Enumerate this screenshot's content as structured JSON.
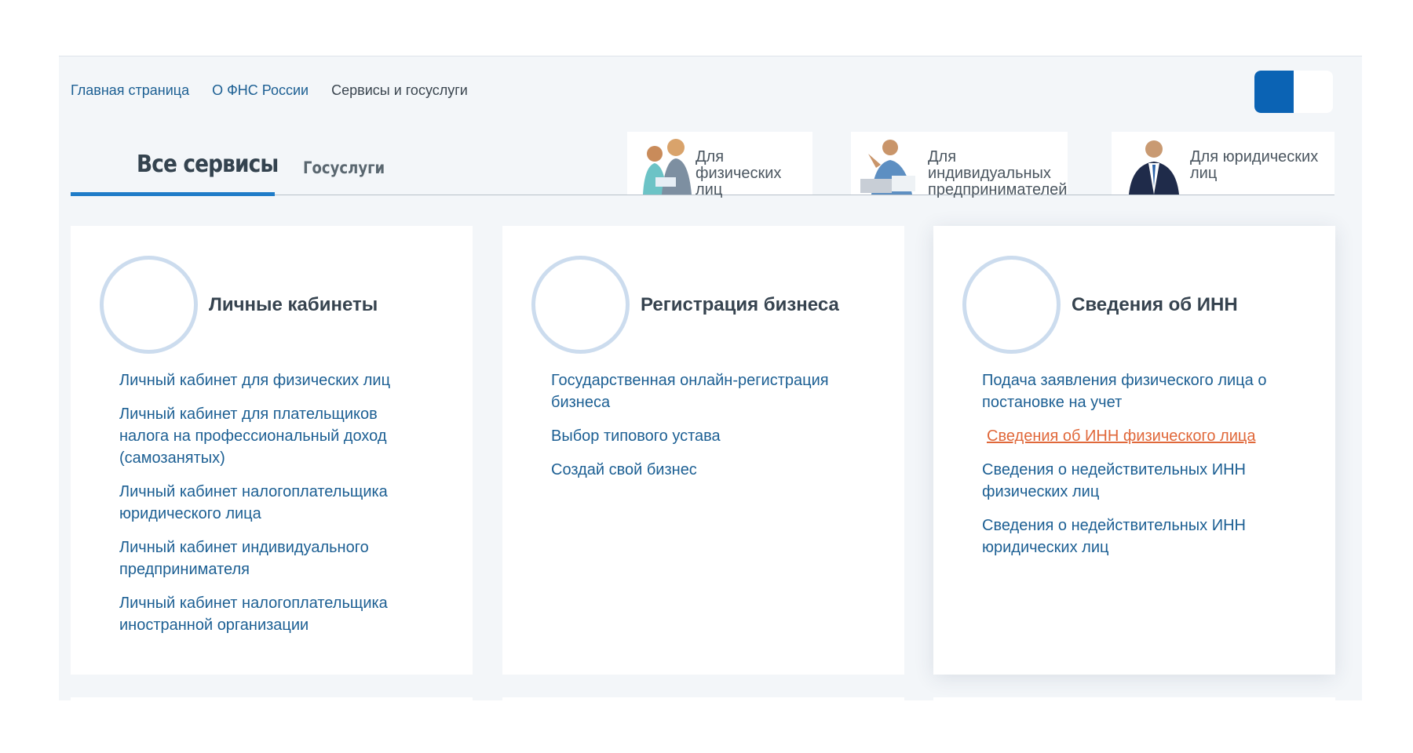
{
  "breadcrumb": [
    {
      "label": "Главная страница"
    },
    {
      "label": "О ФНС России"
    },
    {
      "label": "Сервисы и госуслуги"
    }
  ],
  "tabs": {
    "main": "Все сервисы",
    "second": "Госуслуги"
  },
  "audience": [
    {
      "label": "Для физических лиц"
    },
    {
      "label": "Для индивидуальных предпринимателей"
    },
    {
      "label": "Для юридических лиц"
    }
  ],
  "cards": [
    {
      "title": "Личные кабинеты",
      "links": [
        "Личный кабинет для физических лиц",
        "Личный кабинет для плательщиков налога на профессиональный доход (самозанятых)",
        "Личный кабинет налогоплательщика юридического лица",
        "Личный кабинет индивидуального предпринимателя",
        "Личный кабинет налогоплательщика иностранной организации"
      ]
    },
    {
      "title": "Регистрация бизнеса",
      "links": [
        "Государственная онлайн-регистрация бизнеса",
        "Выбор типового устава",
        "Создай свой бизнес"
      ]
    },
    {
      "title": "Сведения об ИНН",
      "links": [
        "Подача заявления физического лица о постановке на учет",
        "Сведения об ИНН физического лица",
        "Сведения о недействительных ИНН физических лиц",
        "Сведения о недействительных ИНН юридических лиц"
      ]
    }
  ],
  "colors": {
    "link": "#1c5f93",
    "active_link": "#e0683a",
    "accent": "#0b63b4",
    "tab_underline": "#1f7cc8"
  },
  "toggle": {
    "state": "on"
  }
}
